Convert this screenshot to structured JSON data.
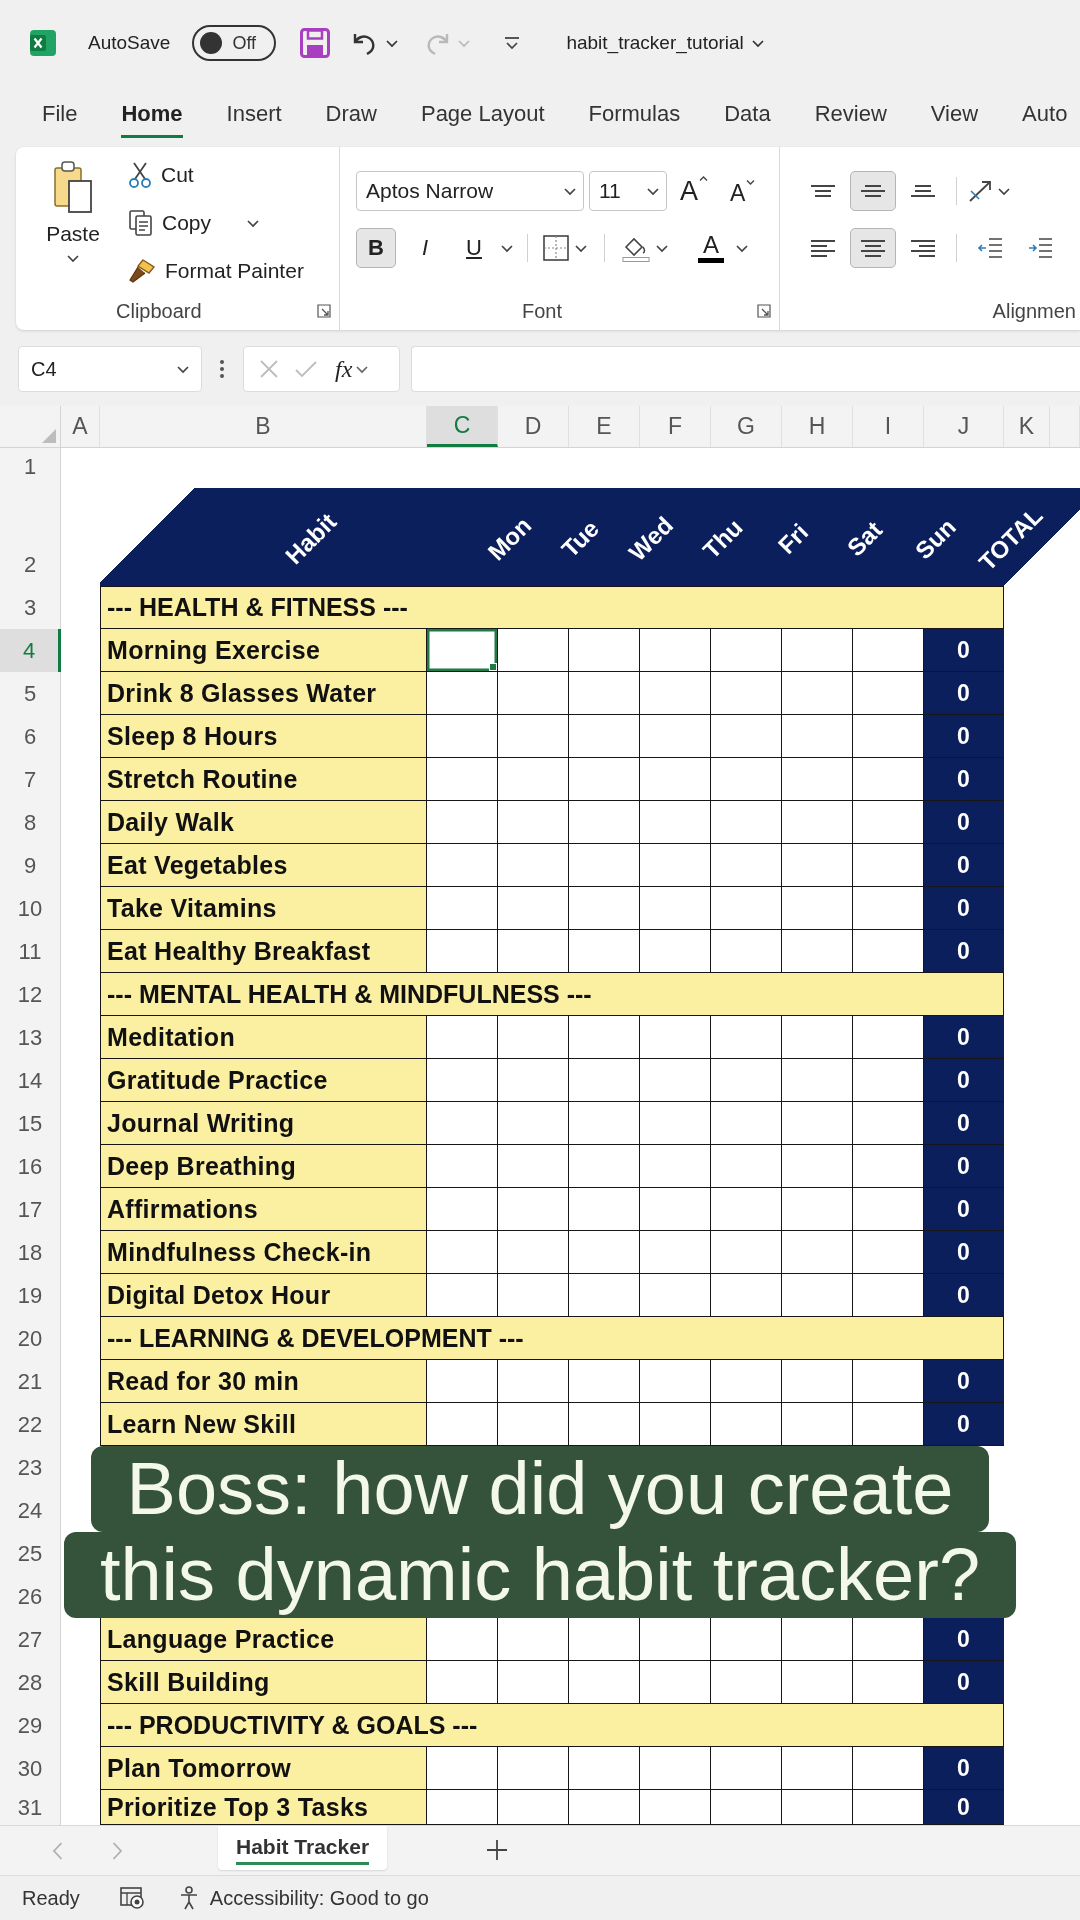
{
  "title_bar": {
    "autosave_label": "AutoSave",
    "autosave": {
      "on": false,
      "label": "Off"
    },
    "undo": {
      "disabled": false
    },
    "redo": {
      "disabled": true
    },
    "file_name": "habit_tracker_tutorial"
  },
  "menu_tabs": [
    {
      "label": "File",
      "selected": false
    },
    {
      "label": "Home",
      "selected": true
    },
    {
      "label": "Insert",
      "selected": false
    },
    {
      "label": "Draw",
      "selected": false
    },
    {
      "label": "Page Layout",
      "selected": false
    },
    {
      "label": "Formulas",
      "selected": false
    },
    {
      "label": "Data",
      "selected": false
    },
    {
      "label": "Review",
      "selected": false
    },
    {
      "label": "View",
      "selected": false
    },
    {
      "label": "Auto",
      "selected": false
    }
  ],
  "ribbon": {
    "clipboard": {
      "paste": "Paste",
      "cut": "Cut",
      "copy": "Copy",
      "format_painter": "Format Painter",
      "label": "Clipboard"
    },
    "font": {
      "name": "Aptos Narrow",
      "size": "11",
      "grow": "A",
      "shrink": "A",
      "styles": [
        {
          "kind": "bold",
          "label": "B",
          "pressed": true
        },
        {
          "kind": "italic",
          "label": "I",
          "pressed": false
        },
        {
          "kind": "underline",
          "label": "U",
          "pressed": false
        }
      ],
      "color_label": "A",
      "label": "Font"
    },
    "alignment": {
      "vertical": [
        {
          "kind": "top",
          "pressed": false
        },
        {
          "kind": "middle",
          "pressed": true
        },
        {
          "kind": "bottom",
          "pressed": false
        }
      ],
      "horizontal": [
        {
          "kind": "left",
          "pressed": false
        },
        {
          "kind": "center",
          "pressed": true
        },
        {
          "kind": "right",
          "pressed": false
        }
      ],
      "label": "Alignmen"
    }
  },
  "formula_bar": {
    "name_box": "C4",
    "function_label": "fx"
  },
  "sheet": {
    "columns": [
      {
        "letter": "A",
        "selected": false
      },
      {
        "letter": "B",
        "selected": false
      },
      {
        "letter": "C",
        "selected": true
      },
      {
        "letter": "D",
        "selected": false
      },
      {
        "letter": "E",
        "selected": false
      },
      {
        "letter": "F",
        "selected": false
      },
      {
        "letter": "G",
        "selected": false
      },
      {
        "letter": "H",
        "selected": false
      },
      {
        "letter": "I",
        "selected": false
      },
      {
        "letter": "J",
        "selected": false
      },
      {
        "letter": "K",
        "selected": false
      }
    ],
    "rows": [
      {
        "number": "1",
        "kind": "blank",
        "selected": false
      },
      {
        "number": "2",
        "kind": "header",
        "selected": false,
        "labels": [
          "Habit",
          "Mon",
          "Tue",
          "Wed",
          "Thu",
          "Fri",
          "Sat",
          "Sun",
          "TOTAL"
        ]
      },
      {
        "number": "3",
        "kind": "section",
        "selected": false,
        "label": "--- HEALTH & FITNESS ---"
      },
      {
        "number": "4",
        "kind": "habit",
        "selected": true,
        "label": "Morning Exercise",
        "total": "0"
      },
      {
        "number": "5",
        "kind": "habit",
        "selected": false,
        "label": "Drink 8 Glasses Water",
        "total": "0"
      },
      {
        "number": "6",
        "kind": "habit",
        "selected": false,
        "label": "Sleep 8 Hours",
        "total": "0"
      },
      {
        "number": "7",
        "kind": "habit",
        "selected": false,
        "label": "Stretch Routine",
        "total": "0"
      },
      {
        "number": "8",
        "kind": "habit",
        "selected": false,
        "label": "Daily Walk",
        "total": "0"
      },
      {
        "number": "9",
        "kind": "habit",
        "selected": false,
        "label": "Eat Vegetables",
        "total": "0"
      },
      {
        "number": "10",
        "kind": "habit",
        "selected": false,
        "label": "Take Vitamins",
        "total": "0"
      },
      {
        "number": "11",
        "kind": "habit",
        "selected": false,
        "label": "Eat Healthy Breakfast",
        "total": "0"
      },
      {
        "number": "12",
        "kind": "section",
        "selected": false,
        "label": "--- MENTAL HEALTH & MINDFULNESS ---"
      },
      {
        "number": "13",
        "kind": "habit",
        "selected": false,
        "label": "Meditation",
        "total": "0"
      },
      {
        "number": "14",
        "kind": "habit",
        "selected": false,
        "label": "Gratitude Practice",
        "total": "0"
      },
      {
        "number": "15",
        "kind": "habit",
        "selected": false,
        "label": "Journal Writing",
        "total": "0"
      },
      {
        "number": "16",
        "kind": "habit",
        "selected": false,
        "label": "Deep Breathing",
        "total": "0"
      },
      {
        "number": "17",
        "kind": "habit",
        "selected": false,
        "label": "Affirmations",
        "total": "0"
      },
      {
        "number": "18",
        "kind": "habit",
        "selected": false,
        "label": "Mindfulness Check-in",
        "total": "0"
      },
      {
        "number": "19",
        "kind": "habit",
        "selected": false,
        "label": "Digital Detox Hour",
        "total": "0"
      },
      {
        "number": "20",
        "kind": "section",
        "selected": false,
        "label": "--- LEARNING & DEVELOPMENT ---"
      },
      {
        "number": "21",
        "kind": "habit",
        "selected": false,
        "label": "Read for 30 min",
        "total": "0"
      },
      {
        "number": "22",
        "kind": "habit",
        "selected": false,
        "label": "Learn New Skill",
        "total": "0"
      },
      {
        "number": "23",
        "kind": "covered",
        "selected": false
      },
      {
        "number": "24",
        "kind": "covered",
        "selected": false
      },
      {
        "number": "25",
        "kind": "covered",
        "selected": false
      },
      {
        "number": "26",
        "kind": "covered",
        "selected": false
      },
      {
        "number": "27",
        "kind": "habit",
        "selected": false,
        "label": "Language Practice",
        "total": "0"
      },
      {
        "number": "28",
        "kind": "habit",
        "selected": false,
        "label": "Skill Building",
        "total": "0"
      },
      {
        "number": "29",
        "kind": "section",
        "selected": false,
        "label": "--- PRODUCTIVITY & GOALS ---"
      },
      {
        "number": "30",
        "kind": "habit",
        "selected": false,
        "label": "Plan Tomorrow",
        "total": "0"
      },
      {
        "number": "31",
        "kind": "habit",
        "selected": false,
        "label": "Prioritize Top 3 Tasks",
        "total": "0"
      }
    ]
  },
  "caption": {
    "lines": [
      "Boss: how did you create",
      "this dynamic habit tracker?"
    ]
  },
  "sheet_tabs": [
    {
      "label": "Habit Tracker",
      "selected": true
    }
  ],
  "status_bar": {
    "mode": "Ready",
    "accessibility": "Accessibility: Good to go"
  }
}
